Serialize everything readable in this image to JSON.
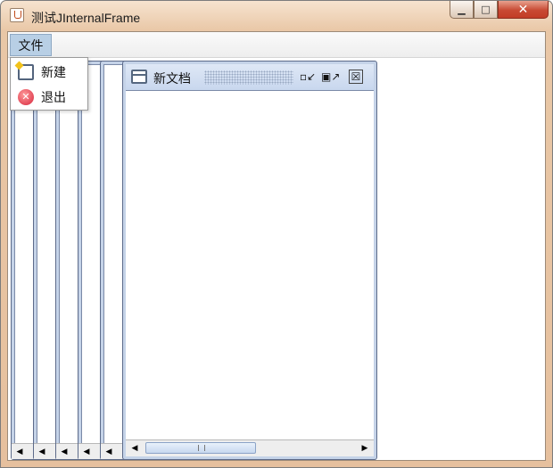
{
  "window": {
    "title": "测试JInternalFrame",
    "controls": {
      "minimize": "▁",
      "maximize": "□",
      "close": "✕"
    }
  },
  "menubar": {
    "file_label": "文件"
  },
  "file_menu": {
    "items": [
      {
        "label": "新建",
        "icon": "new-document-icon"
      },
      {
        "label": "退出",
        "icon": "exit-icon"
      }
    ]
  },
  "internal_frame": {
    "title": "新文档",
    "buttons": {
      "iconify": "▫↙",
      "maximize": "▣↗",
      "close": "☒"
    },
    "stack_count_behind": 5,
    "scroll": {
      "left_arrow": "◀",
      "right_arrow": "▶"
    }
  },
  "colors": {
    "title_gradient_top": "#f6e3cf",
    "menu_selected": "#b8cfe5",
    "frame_border": "#5d6b8a",
    "close_red": "#c84a33"
  }
}
